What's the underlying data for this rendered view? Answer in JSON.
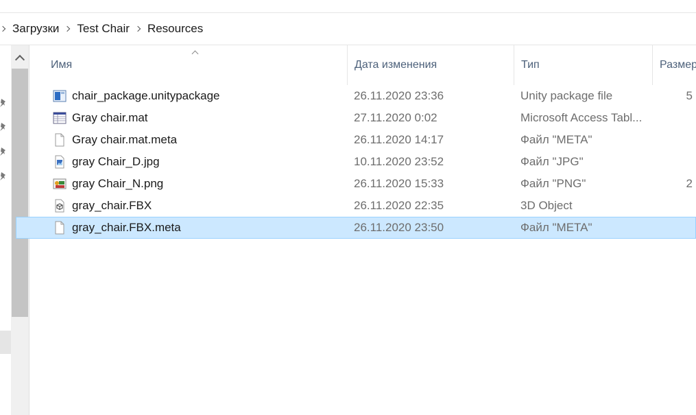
{
  "breadcrumb": {
    "items": [
      "Загрузки",
      "Test Chair",
      "Resources"
    ]
  },
  "columns": {
    "name": "Имя",
    "date": "Дата изменения",
    "type": "Тип",
    "size": "Размер"
  },
  "files": [
    {
      "name": "chair_package.unitypackage",
      "date": "26.11.2020 23:36",
      "type": "Unity package file",
      "size": "5",
      "icon": "unity-package-icon",
      "selected": false
    },
    {
      "name": "Gray chair.mat",
      "date": "27.11.2020 0:02",
      "type": "Microsoft Access Tabl...",
      "size": "",
      "icon": "access-table-icon",
      "selected": false
    },
    {
      "name": "Gray chair.mat.meta",
      "date": "26.11.2020 14:17",
      "type": "Файл \"META\"",
      "size": "",
      "icon": "blank-file-icon",
      "selected": false
    },
    {
      "name": "gray Chair_D.jpg",
      "date": "10.11.2020 23:52",
      "type": "Файл \"JPG\"",
      "size": "",
      "icon": "jpg-image-icon",
      "selected": false
    },
    {
      "name": "gray Chair_N.png",
      "date": "26.11.2020 15:33",
      "type": "Файл \"PNG\"",
      "size": "2",
      "icon": "png-image-icon",
      "selected": false
    },
    {
      "name": "gray_chair.FBX",
      "date": "26.11.2020 22:35",
      "type": "3D Object",
      "size": "",
      "icon": "3d-object-icon",
      "selected": false
    },
    {
      "name": "gray_chair.FBX.meta",
      "date": "26.11.2020 23:50",
      "type": "Файл \"META\"",
      "size": "",
      "icon": "blank-file-icon",
      "selected": true
    }
  ],
  "colors": {
    "selection_bg": "#cce8ff",
    "selection_border": "#99d1ff",
    "header_text": "#4c607a",
    "secondary_text": "#6d6d6d"
  }
}
